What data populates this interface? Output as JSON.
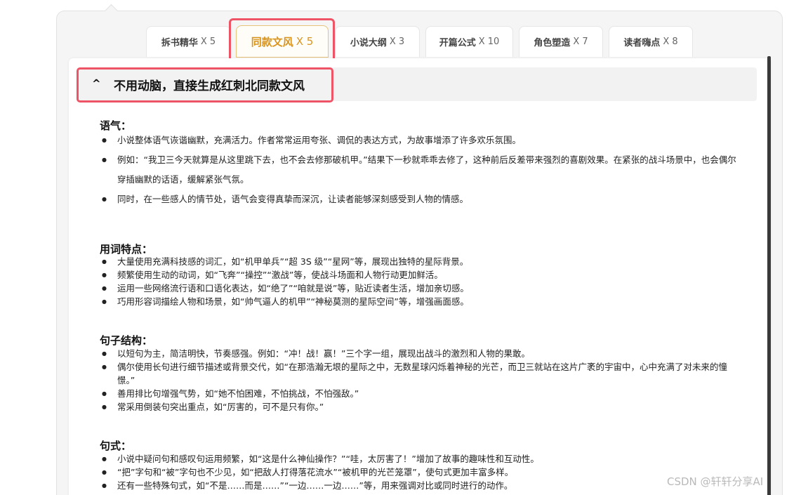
{
  "tabs": [
    {
      "name": "拆书精华",
      "count": "X 5",
      "active": false
    },
    {
      "name": "同款文风",
      "count": "X 5",
      "active": true
    },
    {
      "name": "小说大纲",
      "count": "X 3",
      "active": false
    },
    {
      "name": "开篇公式",
      "count": "X 10",
      "active": false
    },
    {
      "name": "角色塑造",
      "count": "X 7",
      "active": false
    },
    {
      "name": "读者嗨点",
      "count": "X 8",
      "active": false
    }
  ],
  "header": {
    "caret": "^",
    "title": "不用动脑，直接生成红刺北同款文风"
  },
  "sections": [
    {
      "title": "语气：",
      "items": [
        "小说整体语气诙谐幽默，充满活力。作者常常运用夸张、调侃的表达方式，为故事增添了许多欢乐氛围。",
        "例如：“我卫三今天就算是从这里跳下去，也不会去修那破机甲。”结果下一秒就乖乖去修了，这种前后反差带来强烈的喜剧效果。在紧张的战斗场景中，也会偶尔穿插幽默的话语，缓解紧张气氛。",
        "同时，在一些感人的情节处，语气会变得真挚而深沉，让读者能够深刻感受到人物的情感。"
      ]
    },
    {
      "title": "用词特点：",
      "items": [
        "大量使用充满科技感的词汇，如“机甲单兵”“超 3S 级”“星网”等，展现出独特的星际背景。",
        "频繁使用生动的动词，如“飞奔”“操控”“激战”等，使战斗场面和人物行动更加鲜活。",
        "运用一些网络流行语和口语化表达，如“绝了”“咱就是说”等，贴近读者生活，增加亲切感。",
        "巧用形容词描绘人物和场景，如“帅气逼人的机甲”“神秘莫测的星际空间”等，增强画面感。"
      ]
    },
    {
      "title": "句子结构：",
      "items": [
        "以短句为主，简洁明快，节奏感强。例如：“冲！战！赢！”三个字一组，展现出战斗的激烈和人物的果敢。",
        "偶尔使用长句进行细节描述或背景交代，如“在那浩瀚无垠的星际之中，无数星球闪烁着神秘的光芒，而卫三就站在这片广袤的宇宙中，心中充满了对未来的憧憬。”",
        "善用排比句增强气势，如“她不怕困难，不怕挑战，不怕强敌。”",
        "常采用倒装句突出重点，如“厉害的，可不是只有你。”"
      ]
    },
    {
      "title": "句式：",
      "items": [
        "小说中疑问句和感叹句运用频繁，如“这是什么神仙操作？”“哇，太厉害了！”增加了故事的趣味性和互动性。",
        "“把”字句和“被”字句也不少见，如“把敌人打得落花流水”“被机甲的光芒笼罩”，使句式更加丰富多样。",
        "还有一些特殊句式，如“不是……而是……”“一边……一边……”等，用来强调对比或同时进行的动作。"
      ]
    }
  ],
  "watermark": "CSDN @轩轩分享AI",
  "colors": {
    "accent": "#d9941e",
    "highlight": "#ef5366"
  }
}
